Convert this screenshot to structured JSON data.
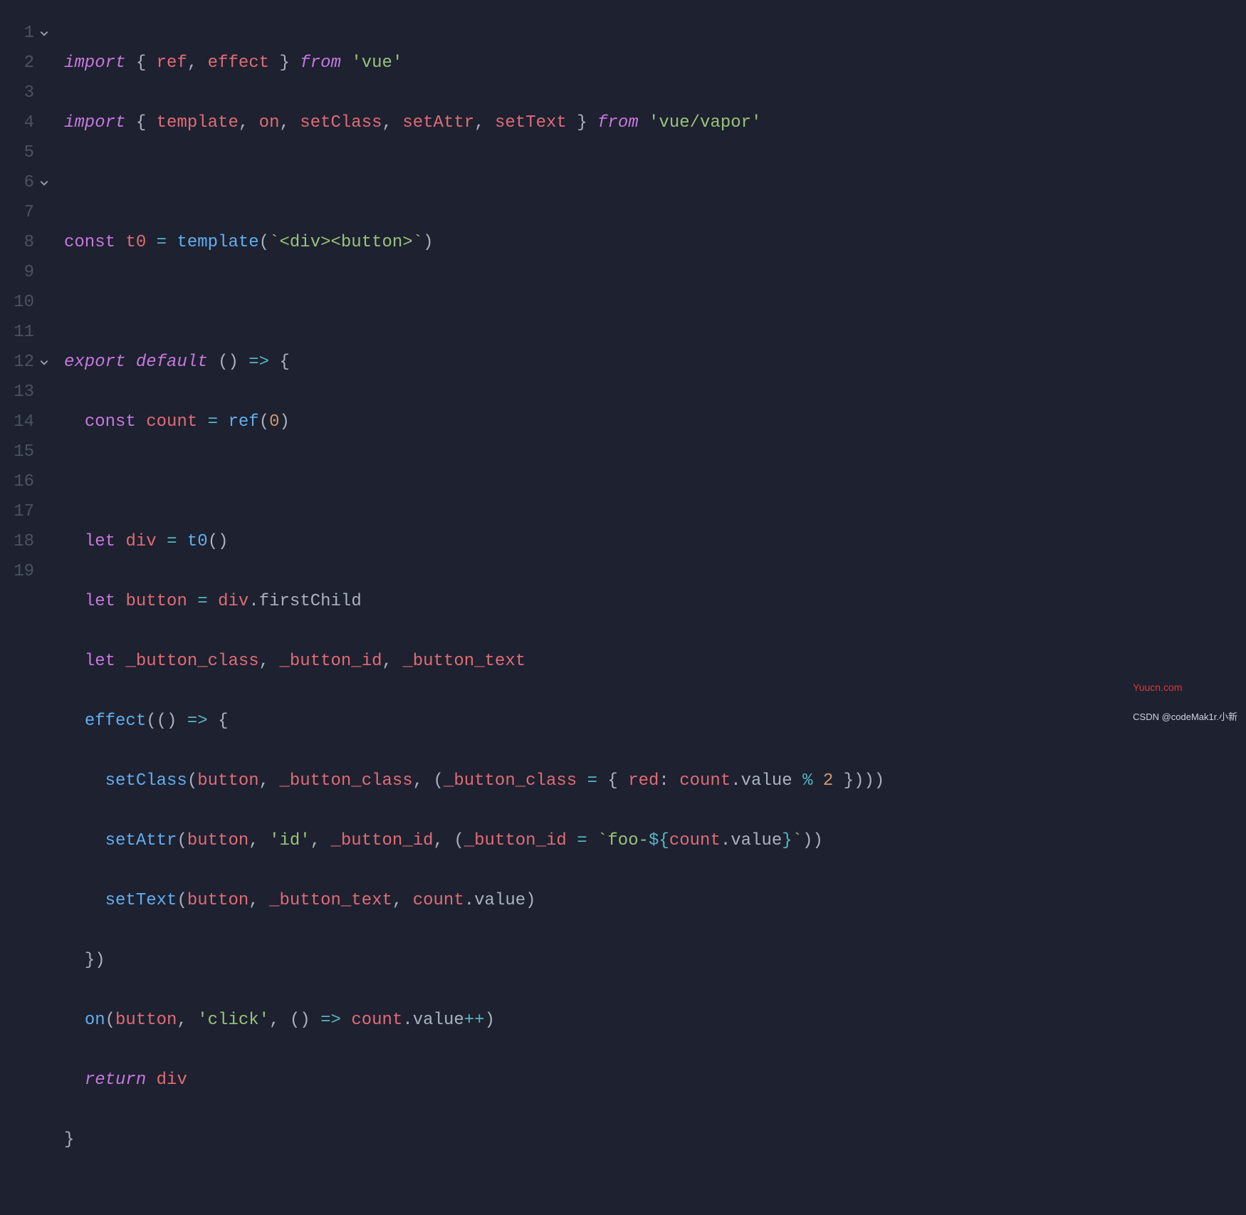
{
  "gutter": {
    "lines": [
      "1",
      "2",
      "3",
      "4",
      "5",
      "6",
      "7",
      "8",
      "9",
      "10",
      "11",
      "12",
      "13",
      "14",
      "15",
      "16",
      "17",
      "18",
      "19"
    ],
    "foldable": [
      1,
      6,
      12
    ]
  },
  "tokens": {
    "l1": {
      "import": "import",
      "brace_l": "{",
      "ref": "ref",
      "comma": ",",
      "effect": "effect",
      "brace_r": "}",
      "from": "from",
      "vue": "'vue'"
    },
    "l2": {
      "import": "import",
      "brace_l": "{",
      "template": "template",
      "c1": ",",
      "on": "on",
      "c2": ",",
      "setClass": "setClass",
      "c3": ",",
      "setAttr": "setAttr",
      "c4": ",",
      "setText": "setText",
      "brace_r": "}",
      "from": "from",
      "vapor": "'vue/vapor'"
    },
    "l4": {
      "const": "const",
      "t0": "t0",
      "eq": "=",
      "template": "template",
      "paren_l": "(",
      "tpl": "`<div><button>`",
      "paren_r": ")"
    },
    "l6": {
      "export": "export",
      "default": "default",
      "paren": "()",
      "arrow": "=>",
      "brace": "{"
    },
    "l7": {
      "const": "const",
      "count": "count",
      "eq": "=",
      "ref": "ref",
      "paren_l": "(",
      "zero": "0",
      "paren_r": ")"
    },
    "l9": {
      "let": "let",
      "div": "div",
      "eq": "=",
      "t0": "t0",
      "call": "()"
    },
    "l10": {
      "let": "let",
      "button": "button",
      "eq": "=",
      "div": "div",
      "dot": ".",
      "firstChild": "firstChild"
    },
    "l11": {
      "let": "let",
      "bc": "_button_class",
      "c1": ",",
      "bi": "_button_id",
      "c2": ",",
      "bt": "_button_text"
    },
    "l12": {
      "effect": "effect",
      "paren_l": "(",
      "paren": "()",
      "arrow": "=>",
      "brace": "{"
    },
    "l13": {
      "setClass": "setClass",
      "pl": "(",
      "button": "button",
      "c1": ",",
      "bc": "_button_class",
      "c2": ",",
      "pl2": "(",
      "bc2": "_button_class",
      "eq": "=",
      "bl": "{",
      "red": "red",
      "colon": ":",
      "count": "count",
      "d1": ".",
      "value": "value",
      "mod": "%",
      "two": "2",
      "br": "}",
      "pr2": ")",
      "pr": "))"
    },
    "l14": {
      "setAttr": "setAttr",
      "pl": "(",
      "button": "button",
      "c1": ",",
      "id": "'id'",
      "c2": ",",
      "bi": "_button_id",
      "c3": ",",
      "pl2": "(",
      "bi2": "_button_id",
      "eq": "=",
      "tpl_l": "`foo-",
      "dollar": "${",
      "count": "count",
      "d1": ".",
      "value": "value",
      "brace_r": "}",
      "tpl_r": "`",
      "pr2": ")",
      "pr": ")"
    },
    "l15": {
      "setText": "setText",
      "pl": "(",
      "button": "button",
      "c1": ",",
      "bt": "_button_text",
      "c2": ",",
      "count": "count",
      "d1": ".",
      "value": "value",
      "pr": ")"
    },
    "l16": {
      "close": "})"
    },
    "l17": {
      "on": "on",
      "pl": "(",
      "button": "button",
      "c1": ",",
      "click": "'click'",
      "c2": ",",
      "paren": "()",
      "arrow": "=>",
      "count": "count",
      "d1": ".",
      "value": "value",
      "inc": "++",
      "pr": ")"
    },
    "l18": {
      "return": "return",
      "div": "div"
    },
    "l19": {
      "close": "}"
    }
  },
  "watermark": {
    "site": "Yuucn.com",
    "attribution": "CSDN @codeMak1r.小新"
  }
}
